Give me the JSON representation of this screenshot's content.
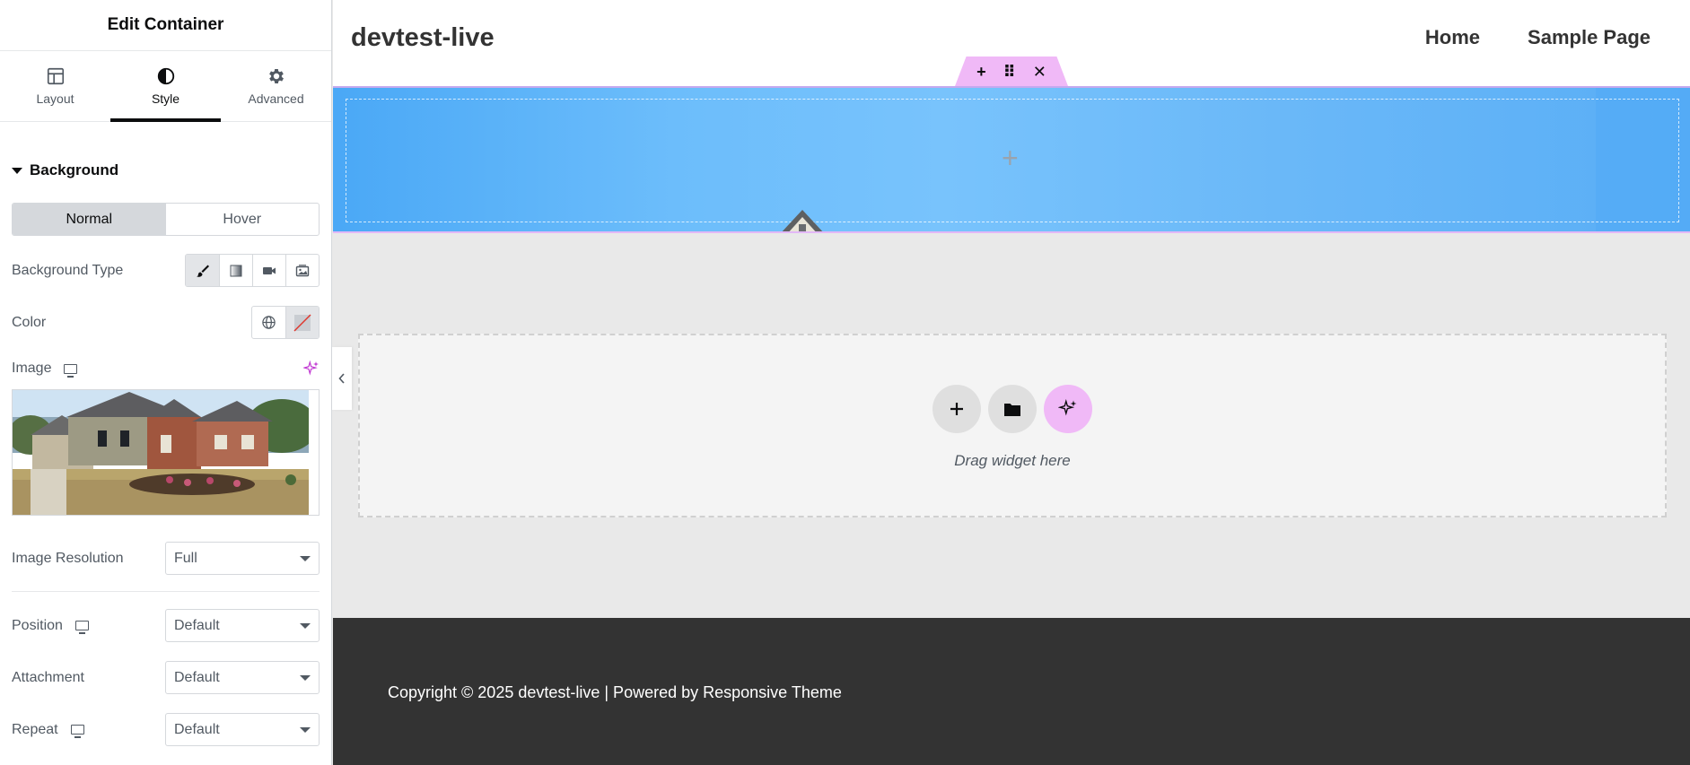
{
  "panel": {
    "title": "Edit Container",
    "tabs": [
      {
        "label": "Layout",
        "icon": "layout-icon"
      },
      {
        "label": "Style",
        "icon": "style-icon",
        "active": true
      },
      {
        "label": "Advanced",
        "icon": "gear-icon"
      }
    ],
    "section": "Background",
    "state_toggle": {
      "normal": "Normal",
      "hover": "Hover",
      "selected": "Normal"
    },
    "background_type_label": "Background Type",
    "background_type_options": [
      "classic-brush-icon",
      "gradient-icon",
      "video-icon",
      "slideshow-icon"
    ],
    "color_label": "Color",
    "image_label": "Image",
    "image_resolution_label": "Image Resolution",
    "image_resolution_value": "Full",
    "position_label": "Position",
    "position_value": "Default",
    "attachment_label": "Attachment",
    "attachment_value": "Default",
    "repeat_label": "Repeat",
    "repeat_value": "Default"
  },
  "site": {
    "title": "devtest-live",
    "nav": [
      "Home",
      "Sample Page"
    ],
    "handle": {
      "add": "+",
      "move": "⠿",
      "close": "✕"
    },
    "dropzone_text": "Drag widget here",
    "footer": "Copyright © 2025 devtest-live | Powered by Responsive Theme"
  },
  "colors": {
    "accent": "#f0b9f7",
    "hero_blue": "#6cbdfb",
    "footer_bg": "#333333",
    "canvas_bg": "#e9e9e9"
  }
}
